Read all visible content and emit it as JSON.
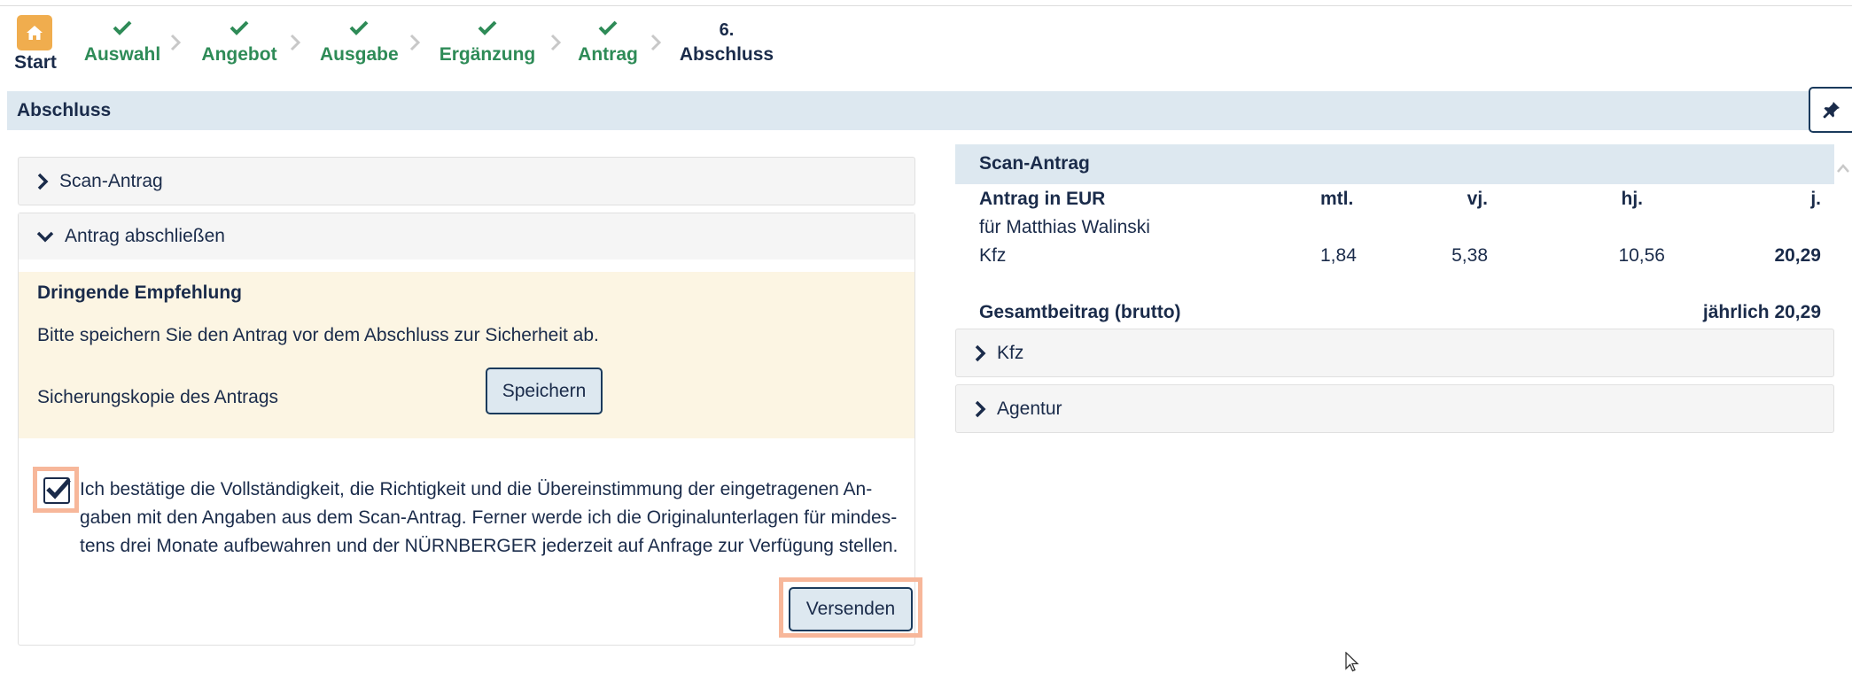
{
  "stepper": {
    "start_label": "Start",
    "steps": [
      {
        "label": "Auswahl",
        "status": "done"
      },
      {
        "label": "Angebot",
        "status": "done"
      },
      {
        "label": "Ausgabe",
        "status": "done"
      },
      {
        "label": "Ergänzung",
        "status": "done"
      },
      {
        "label": "Antrag",
        "status": "done"
      },
      {
        "label": "Abschluss",
        "number": "6.",
        "status": "current"
      }
    ]
  },
  "section": {
    "title": "Abschluss"
  },
  "left": {
    "scan_panel_label": "Scan-Antrag",
    "antrag_panel_label": "Antrag abschließen",
    "warning": {
      "title": "Dringende Empfehlung",
      "text": "Bitte speichern Sie den Antrag vor dem Abschluss zur Sicherheit ab.",
      "backup_label": "Sicherungskopie des Antrags",
      "save_label": "Speichern"
    },
    "confirm": {
      "checked": true,
      "line1": "Ich bestätige die Vollständigkeit, die Richtigkeit und die Übereinstimmung der eingetragenen An-",
      "line2": "gaben mit den Angaben aus dem Scan-Antrag. Ferner werde ich die Originalunterlagen für mindes-",
      "line3": "tens drei Monate aufbewahren und der NÜRNBERGER jederzeit auf Anfrage zur Verfügung stellen."
    },
    "send_label": "Versenden"
  },
  "right": {
    "title": "Scan-Antrag",
    "table": {
      "header": {
        "label": "Antrag in EUR",
        "mtl": "mtl.",
        "vj": "vj.",
        "hj": "hj.",
        "j": "j."
      },
      "for_label": "für Matthias Walinski",
      "rows": [
        {
          "label": "Kfz",
          "mtl": "1,84",
          "vj": "5,38",
          "hj": "10,56",
          "j": "20,29"
        }
      ],
      "total_label": "Gesamtbeitrag (brutto)",
      "total_value": "jährlich 20,29"
    },
    "kfz_panel_label": "Kfz",
    "agentur_panel_label": "Agentur"
  },
  "colors": {
    "done": "#2e8b57",
    "accent_home": "#f0ad4e",
    "section_bg": "#dde8f0",
    "warning_bg": "#fcf5e3",
    "highlight": "#f7b79a"
  }
}
